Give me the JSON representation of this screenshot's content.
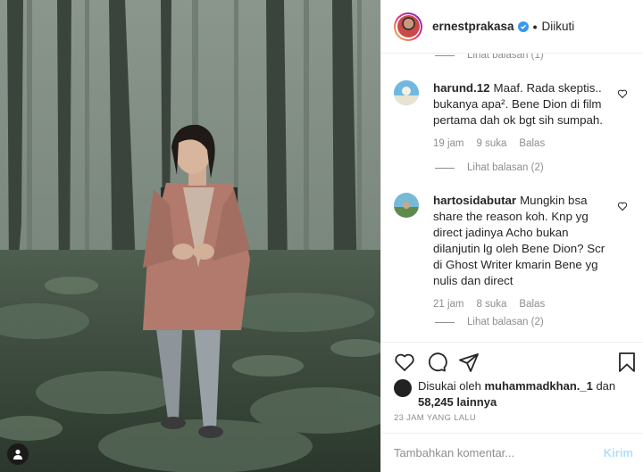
{
  "header": {
    "username": "ernestprakasa",
    "separator": "•",
    "follow_status": "Diikuti"
  },
  "comments": {
    "top_replies": "Lihat balasan (1)",
    "items": [
      {
        "username": "harund.12",
        "text": "Maaf. Rada skeptis.. bukanya apa². Bene Dion di film pertama dah ok bgt sih sumpah.",
        "time": "19 jam",
        "likes": "9 suka",
        "reply": "Balas",
        "view_replies": "Lihat balasan (2)"
      },
      {
        "username": "hartosidabutar",
        "text": "Mungkin bsa share the reason koh. Knp yg direct jadinya Acho bukan dilanjutin lg oleh Bene Dion? Scr di Ghost Writer kmarin Bene yg nulis dan direct",
        "time": "21 jam",
        "likes": "8 suka",
        "reply": "Balas",
        "view_replies": "Lihat balasan (2)"
      }
    ]
  },
  "likes": {
    "prefix": "Disukai oleh",
    "user": "muhammadkhan._1",
    "conjunction": "dan",
    "others": "58,245 lainnya"
  },
  "timestamp": "23 JAM YANG LALU",
  "add_comment": {
    "placeholder": "Tambahkan komentar...",
    "post_label": "Kirim"
  },
  "colors": {
    "verified": "#3897f0",
    "muted": "#8e8e8e",
    "post_disabled": "#b2dffc"
  }
}
